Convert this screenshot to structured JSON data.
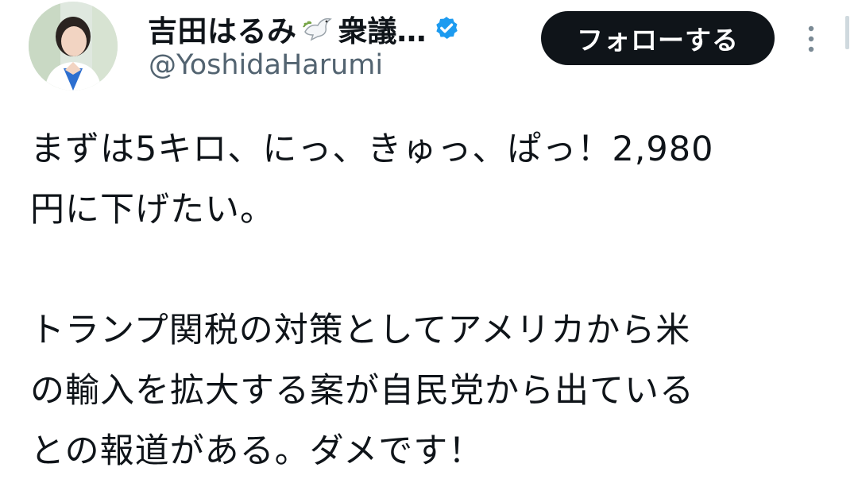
{
  "profile": {
    "display_name": "吉田はるみ",
    "display_name_suffix": "衆議…",
    "handle": "@YoshidaHarumi",
    "follow_label": "フォローする"
  },
  "icons": {
    "avatar": "avatar",
    "dove": "dove-icon",
    "verified": "verified-badge-icon",
    "more": "more-vertical-icon"
  },
  "colors": {
    "verified_blue": "#1d9bf0",
    "follow_bg": "#0f1419",
    "handle_gray": "#536471"
  },
  "tweet": {
    "paragraph_1": "まずは5キロ、にっ、きゅっ、ぱっ！2,980\n円に下げたい。",
    "paragraph_2": "トランプ関税の対策としてアメリカから米\nの輸入を拡大する案が自民党から出ている\nとの報道がある。ダメです！"
  }
}
